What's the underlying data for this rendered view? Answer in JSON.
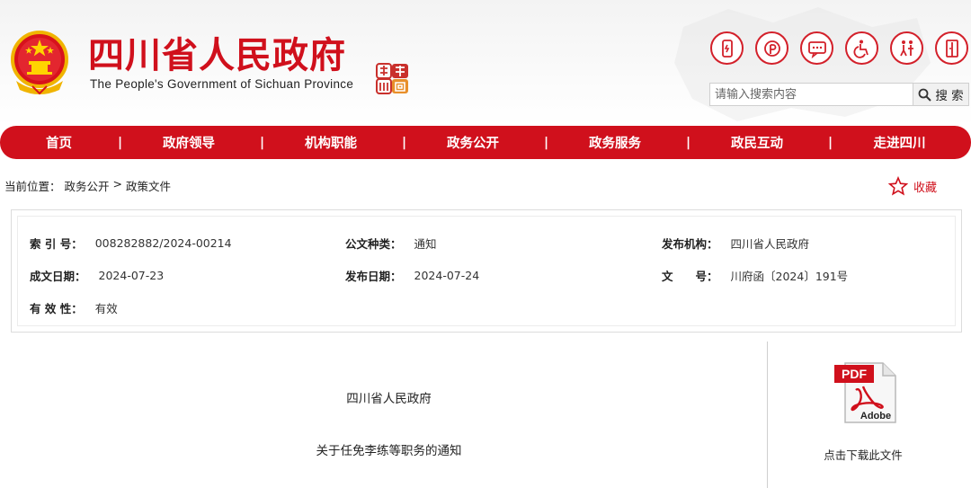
{
  "header": {
    "title": "四川省人民政府",
    "subtitle": "The People's Government of Sichuan Province",
    "search": {
      "placeholder": "请输入搜索内容",
      "button_label": "搜 索"
    },
    "tool_icons": [
      "mobile-icon",
      "weibo-icon",
      "message-icon",
      "accessibility-icon",
      "elderly-care-icon",
      "exit-icon"
    ]
  },
  "nav": {
    "items": [
      "首页",
      "政府领导",
      "机构职能",
      "政务公开",
      "政务服务",
      "政民互动",
      "走进四川"
    ],
    "separator": "|"
  },
  "breadcrumb": {
    "prefix": "当前位置：",
    "items": [
      "政务公开",
      "政策文件"
    ],
    "separator": ">"
  },
  "favorite": {
    "label": "收藏"
  },
  "info": {
    "index": {
      "label": "索 引 号：",
      "value": "008282882/2024-00214"
    },
    "doc_type": {
      "label": "公文种类：",
      "value": "通知"
    },
    "publisher": {
      "label": "发布机构：",
      "value": "四川省人民政府"
    },
    "written_date": {
      "label": "成文日期：",
      "value": "2024-07-23"
    },
    "publish_date": {
      "label": "发布日期：",
      "value": "2024-07-24"
    },
    "doc_number": {
      "label": "文　　号：",
      "value": "川府函〔2024〕191号"
    },
    "validity": {
      "label": "有 效 性：",
      "value": "有效"
    }
  },
  "document": {
    "issuer": "四川省人民政府",
    "title": "关于任免李练等职务的通知"
  },
  "download": {
    "icon_top": "PDF",
    "icon_bottom": "Adobe",
    "label": "点击下载此文件"
  },
  "colors": {
    "brand_red": "#d0101c",
    "icon_red": "#d3202a",
    "border": "#dcdcdc"
  }
}
